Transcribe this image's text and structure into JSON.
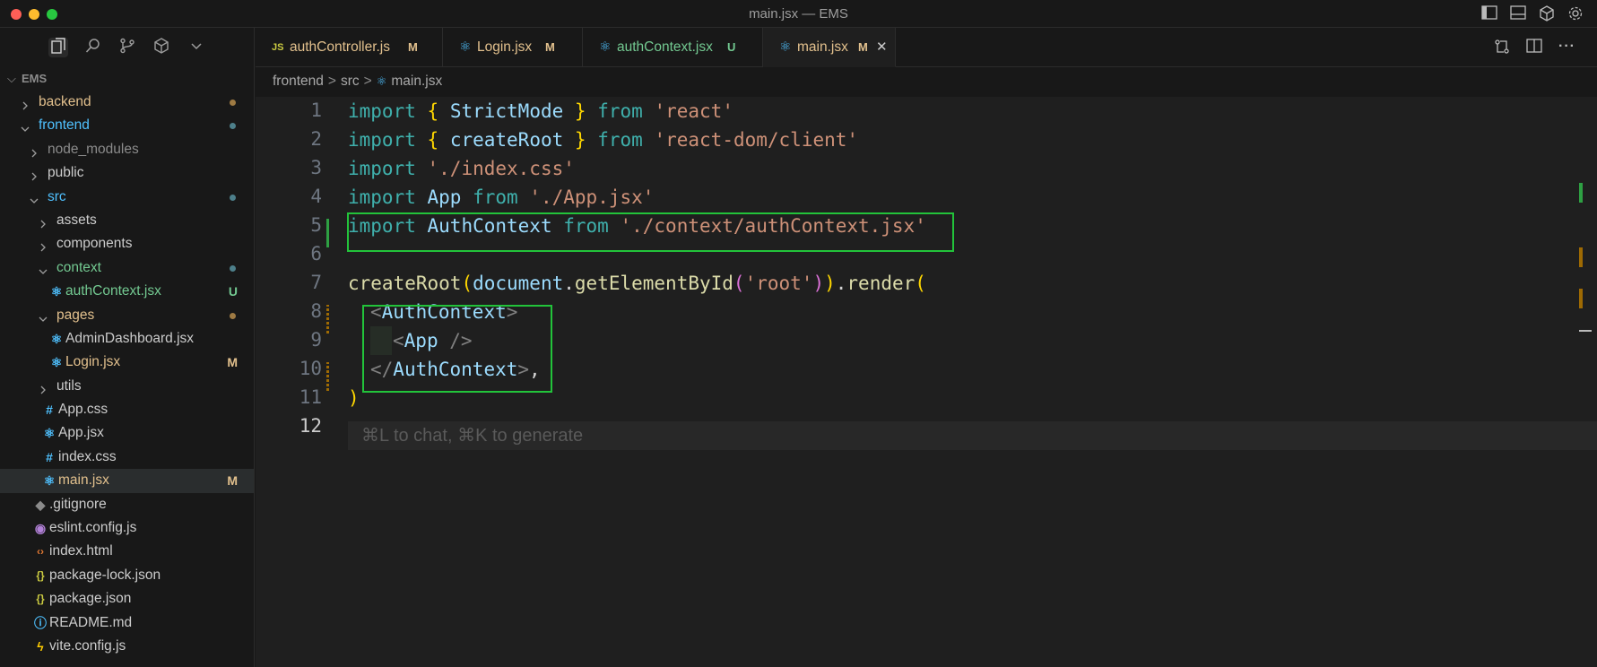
{
  "window": {
    "title": "main.jsx — EMS"
  },
  "explorer": {
    "root": "EMS",
    "items": [
      {
        "label": "backend",
        "type": "folder",
        "depth": 0,
        "open": false,
        "color": "#e2c08d",
        "dot": "#9e7a43"
      },
      {
        "label": "frontend",
        "type": "folder",
        "depth": 0,
        "open": true,
        "color": "#4fc1ff",
        "dot": "#4d7f8a"
      },
      {
        "label": "node_modules",
        "type": "folder",
        "depth": 1,
        "open": false,
        "color": "#8b8b8b"
      },
      {
        "label": "public",
        "type": "folder",
        "depth": 1,
        "open": false,
        "color": "#cccccc"
      },
      {
        "label": "src",
        "type": "folder",
        "depth": 1,
        "open": true,
        "color": "#4fc1ff",
        "dot": "#4d7f8a"
      },
      {
        "label": "assets",
        "type": "folder",
        "depth": 2,
        "open": false,
        "color": "#cccccc"
      },
      {
        "label": "components",
        "type": "folder",
        "depth": 2,
        "open": false,
        "color": "#cccccc"
      },
      {
        "label": "context",
        "type": "folder",
        "depth": 2,
        "open": true,
        "color": "#73c991",
        "dot": "#4d7f8a"
      },
      {
        "label": "authContext.jsx",
        "type": "react",
        "depth": 3,
        "color": "#73c991",
        "badge": "U"
      },
      {
        "label": "pages",
        "type": "folder",
        "depth": 2,
        "open": true,
        "color": "#e2c08d",
        "dot": "#9e7a43"
      },
      {
        "label": "AdminDashboard.jsx",
        "type": "react",
        "depth": 3,
        "color": "#cccccc"
      },
      {
        "label": "Login.jsx",
        "type": "react",
        "depth": 3,
        "color": "#e2c08d",
        "badge": "M"
      },
      {
        "label": "utils",
        "type": "folder",
        "depth": 2,
        "open": false,
        "color": "#cccccc"
      },
      {
        "label": "App.css",
        "type": "css",
        "depth": 2,
        "color": "#cccccc"
      },
      {
        "label": "App.jsx",
        "type": "react",
        "depth": 2,
        "color": "#cccccc"
      },
      {
        "label": "index.css",
        "type": "css",
        "depth": 2,
        "color": "#cccccc"
      },
      {
        "label": "main.jsx",
        "type": "react",
        "depth": 2,
        "color": "#e2c08d",
        "badge": "M",
        "selected": true
      },
      {
        "label": ".gitignore",
        "type": "git",
        "depth": 1,
        "color": "#cccccc"
      },
      {
        "label": "eslint.config.js",
        "type": "eslint",
        "depth": 1,
        "color": "#cccccc"
      },
      {
        "label": "index.html",
        "type": "html",
        "depth": 1,
        "color": "#cccccc"
      },
      {
        "label": "package-lock.json",
        "type": "json",
        "depth": 1,
        "color": "#cccccc"
      },
      {
        "label": "package.json",
        "type": "json",
        "depth": 1,
        "color": "#cccccc"
      },
      {
        "label": "README.md",
        "type": "info",
        "depth": 1,
        "color": "#cccccc"
      },
      {
        "label": "vite.config.js",
        "type": "vite",
        "depth": 1,
        "color": "#cccccc"
      }
    ]
  },
  "tabs": [
    {
      "icon": "JS",
      "name": "authController.js",
      "badge": "M",
      "color": "#e2c08d"
    },
    {
      "icon": "⚛",
      "name": "Login.jsx",
      "badge": "M",
      "color": "#e2c08d"
    },
    {
      "icon": "⚛",
      "name": "authContext.jsx",
      "badge": "U",
      "color": "#73c991"
    },
    {
      "icon": "⚛",
      "name": "main.jsx",
      "badge": "M",
      "color": "#e2c08d",
      "active": true,
      "close": "✕"
    }
  ],
  "breadcrumb": {
    "part1": "frontend",
    "part2": "src",
    "part3": "main.jsx",
    "sep": ">"
  },
  "editor": {
    "line_numbers": [
      "1",
      "2",
      "3",
      "4",
      "5",
      "6",
      "7",
      "8",
      "9",
      "10",
      "11",
      "12"
    ],
    "lines": {
      "l1": {
        "a": "import",
        "b": "{",
        "c": "StrictMode",
        "d": "}",
        "e": "from",
        "f": "'react'"
      },
      "l2": {
        "a": "import",
        "b": "{",
        "c": "createRoot",
        "d": "}",
        "e": "from",
        "f": "'react-dom/client'"
      },
      "l3": {
        "a": "import",
        "f": "'./index.css'"
      },
      "l4": {
        "a": "import",
        "c": "App",
        "e": "from",
        "f": "'./App.jsx'"
      },
      "l5": {
        "a": "import",
        "c": "AuthContext",
        "e": "from",
        "f": "'./context/authContext.jsx'"
      },
      "l7": {
        "fn1": "createRoot",
        "p1": "(",
        "obj": "document",
        "dot": ".",
        "fn2": "getElementById",
        "p2": "(",
        "s": "'root'",
        "p3": ")",
        "p4": ")",
        "dot2": ".",
        "fn3": "render",
        "p5": "("
      },
      "l8": {
        "lt": "<",
        "tag": "AuthContext",
        "gt": ">"
      },
      "l9": {
        "lt": "<",
        "tag": "App",
        "end": " />"
      },
      "l10": {
        "lt": "</",
        "tag": "AuthContext",
        "gt": ">",
        "comma": ","
      },
      "l11": {
        "p": ")"
      }
    },
    "hint": "⌘L to chat, ⌘K to generate"
  }
}
